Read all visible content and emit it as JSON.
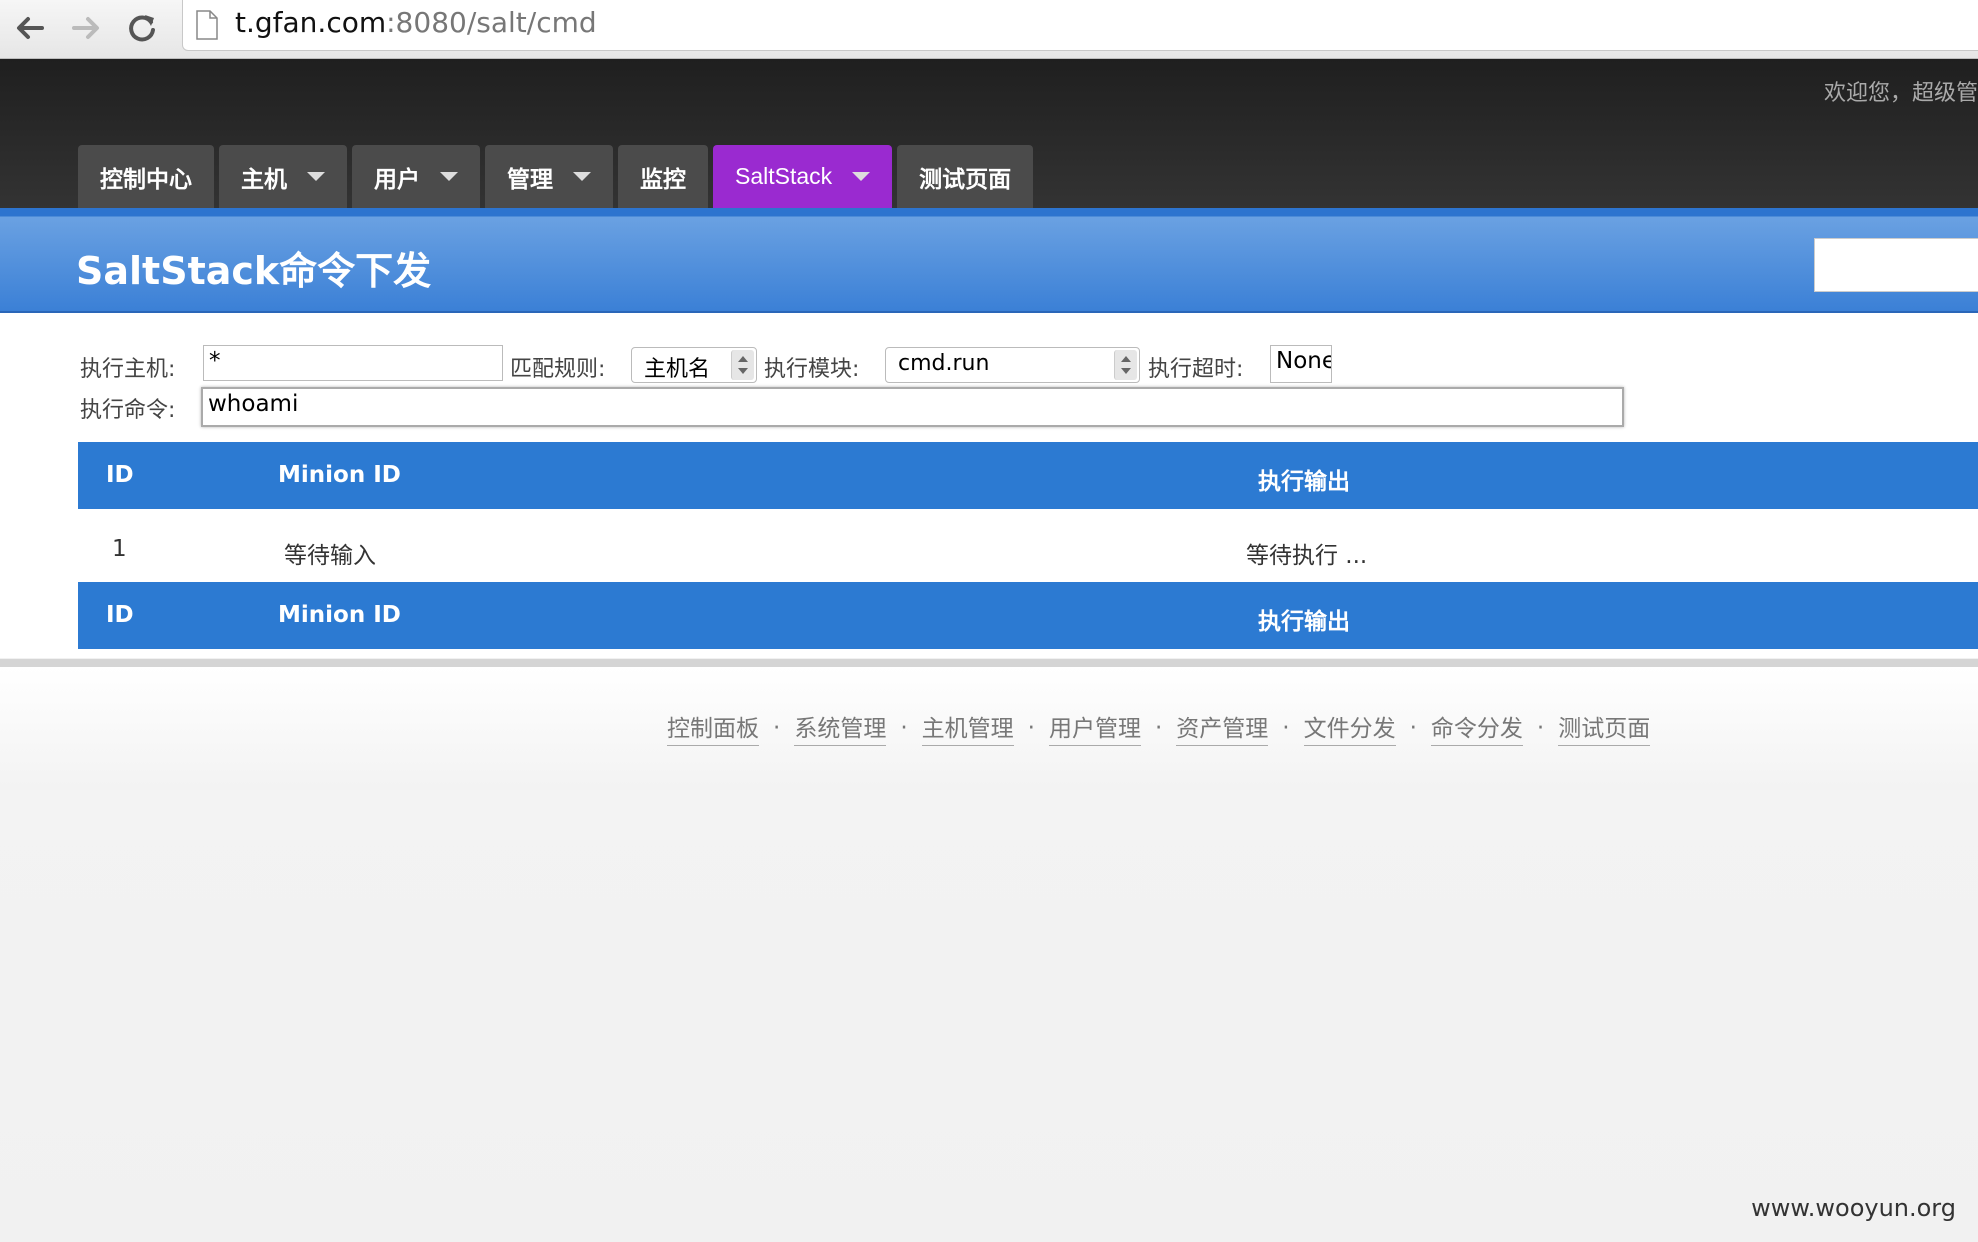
{
  "browser": {
    "url_host": "t.gfan.com",
    "url_rest": ":8080/salt/cmd"
  },
  "header": {
    "welcome": "欢迎您，超级管"
  },
  "menu": [
    {
      "label": "控制中心",
      "dropdown": false
    },
    {
      "label": "主机",
      "dropdown": true
    },
    {
      "label": "用户",
      "dropdown": true
    },
    {
      "label": "管理",
      "dropdown": true
    },
    {
      "label": "监控",
      "dropdown": false
    },
    {
      "label": "SaltStack",
      "dropdown": true,
      "active": true
    },
    {
      "label": "测试页面",
      "dropdown": false
    }
  ],
  "page": {
    "title": "SaltStack命令下发"
  },
  "form": {
    "host_label": "执行主机:",
    "host_value": "*",
    "match_label": "匹配规则:",
    "match_value": "主机名",
    "module_label": "执行模块:",
    "module_value": "cmd.run",
    "timeout_label": "执行超时:",
    "timeout_value": "None",
    "command_label": "执行命令:",
    "command_value": "whoami"
  },
  "table": {
    "columns": [
      "ID",
      "Minion ID",
      "执行输出"
    ],
    "rows": [
      {
        "id": "1",
        "minion": "等待输入",
        "output": "等待执行 ..."
      }
    ]
  },
  "footer": {
    "links": [
      "控制面板",
      "系统管理",
      "主机管理",
      "用户管理",
      "资产管理",
      "文件分发",
      "命令分发",
      "测试页面"
    ],
    "separator": "·",
    "watermark": "www.wooyun.org"
  },
  "colors": {
    "menu_active": "#9a2ad0",
    "banner": "#3b80d6",
    "table_header": "#2c7ad2"
  }
}
